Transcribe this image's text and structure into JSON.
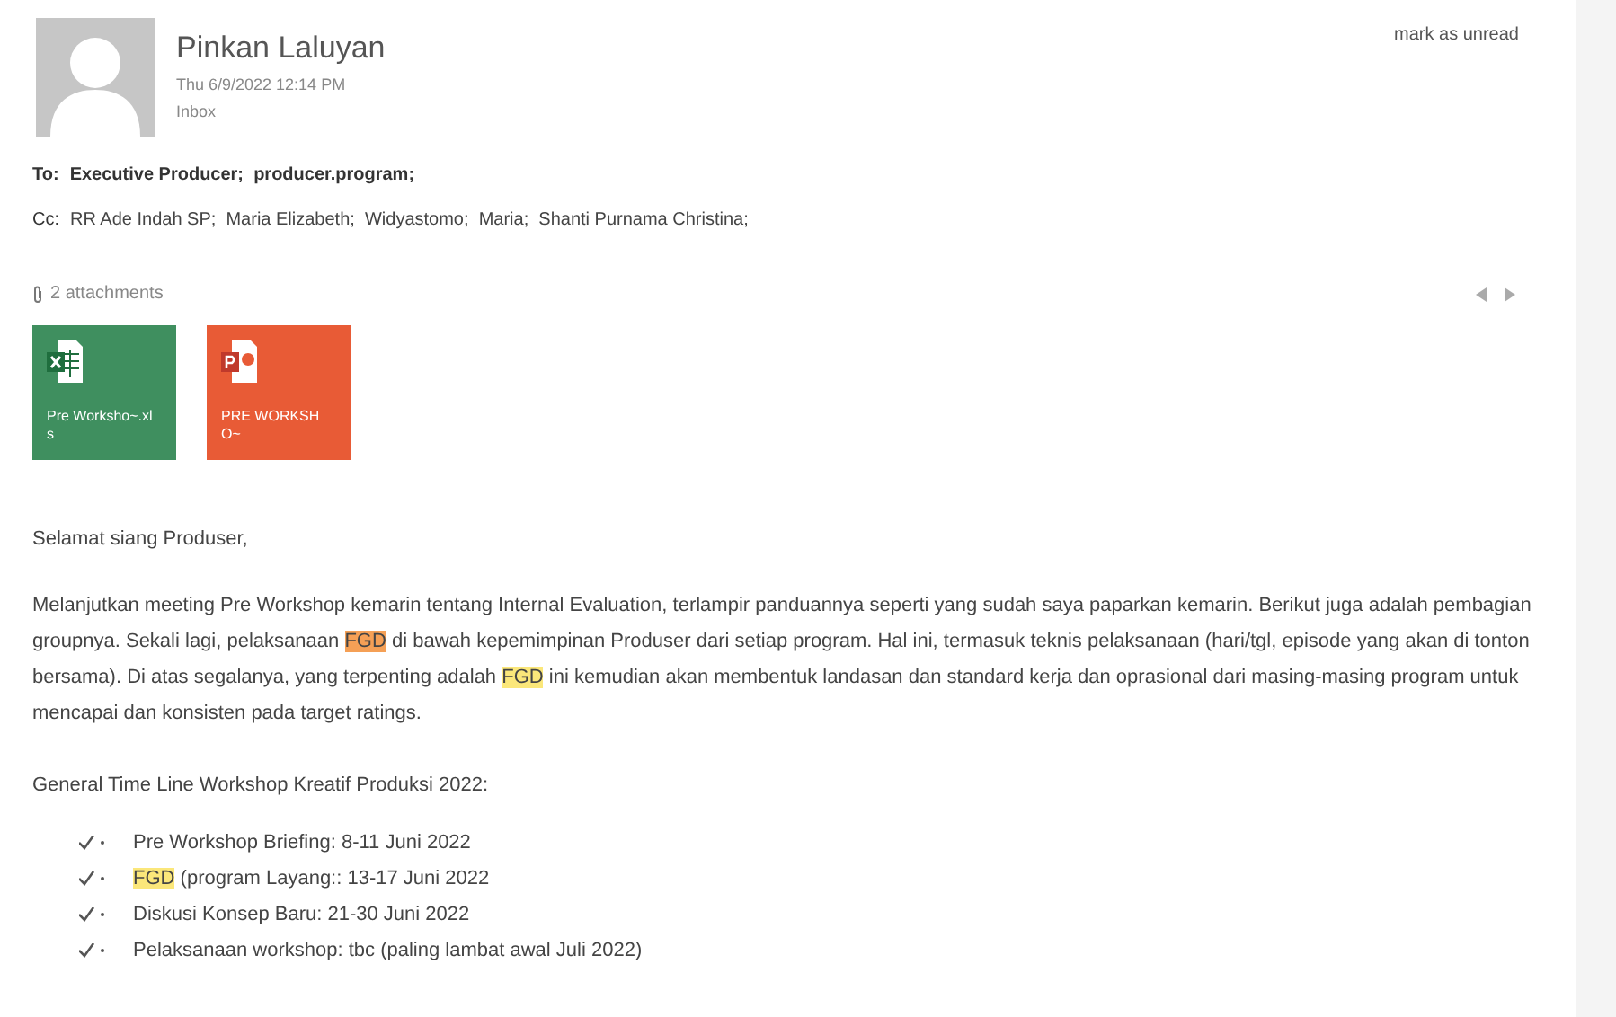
{
  "header": {
    "sender": "Pinkan Laluyan",
    "date": "Thu 6/9/2022 12:14 PM",
    "folder": "Inbox",
    "mark_unread": "mark as unread"
  },
  "to": {
    "label": "To:",
    "recipients": "Executive Producer;  producer.program;"
  },
  "cc": {
    "label": "Cc:",
    "recipients": "RR Ade Indah SP;  Maria Elizabeth;  Widyastomo;  Maria;  Shanti Purnama Christina;"
  },
  "attachments": {
    "label": "2 attachments",
    "items": [
      {
        "kind": "xlsx",
        "name": "Pre Worksho~.xls"
      },
      {
        "kind": "pptx",
        "name": "PRE WORKSHO~"
      }
    ]
  },
  "body": {
    "greeting": "Selamat siang Produser,",
    "paragraph": [
      {
        "text": "Melanjutkan meeting Pre Workshop kemarin tentang Internal Evaluation, terlampir panduannya seperti yang sudah saya paparkan kemarin. Berikut juga adalah pembagian groupnya. Sekali lagi, pelaksanaan "
      },
      {
        "text": "FGD",
        "color": "#f5a056"
      },
      {
        "text": " di bawah kepemimpinan Produser dari setiap program. Hal ini, termasuk teknis pelaksanaan (hari/tgl, episode yang akan di tonton bersama). Di atas segalanya, yang terpenting adalah "
      },
      {
        "text": "FGD",
        "color": "#fbe77a"
      },
      {
        "text": " ini kemudian akan membentuk landasan dan standard kerja dan oprasional dari masing-masing program untuk mencapai dan konsisten pada target ratings."
      }
    ],
    "timeline_title": "General Time Line Workshop Kreatif Produksi 2022:",
    "timeline": [
      [
        {
          "text": "Pre Workshop Briefing: 8-11 Juni 2022"
        }
      ],
      [
        {
          "text": "FGD",
          "color": "#fbe77a"
        },
        {
          "text": " (program Layang:: 13-17 Juni 2022"
        }
      ],
      [
        {
          "text": "Diskusi Konsep Baru: 21-30 Juni 2022"
        }
      ],
      [
        {
          "text": "Pelaksanaan workshop: tbc (paling lambat awal Juli 2022)"
        }
      ]
    ]
  }
}
